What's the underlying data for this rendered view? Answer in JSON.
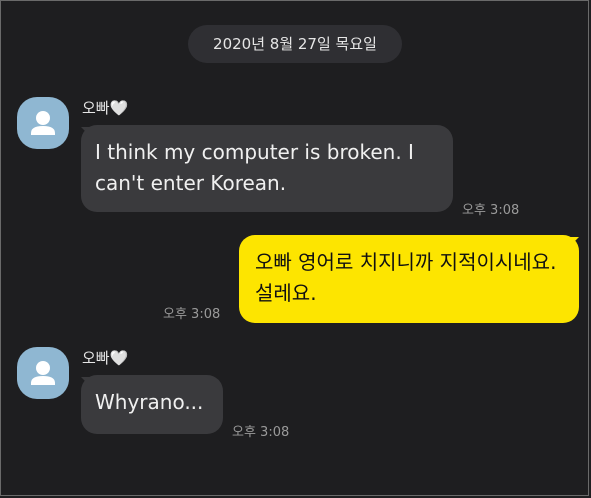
{
  "date_divider": "2020년 8월 27일 목요일",
  "messages": [
    {
      "sender": "오빠🤍",
      "text": "I think my computer is broken. I can't enter Korean.",
      "time": "오후 3:08"
    },
    {
      "sender": "me",
      "text": "오빠 영어로 치지니까 지적이시네요. 설레요.",
      "time": "오후 3:08"
    },
    {
      "sender": "오빠🤍",
      "text": "Whyrano...",
      "time": "오후 3:08"
    }
  ],
  "colors": {
    "background": "#1e1e20",
    "incoming_bubble": "#3a3a3d",
    "outgoing_bubble": "#fde500",
    "avatar": "#8fb7d2"
  },
  "icons": {
    "avatar": "default-profile-icon"
  }
}
